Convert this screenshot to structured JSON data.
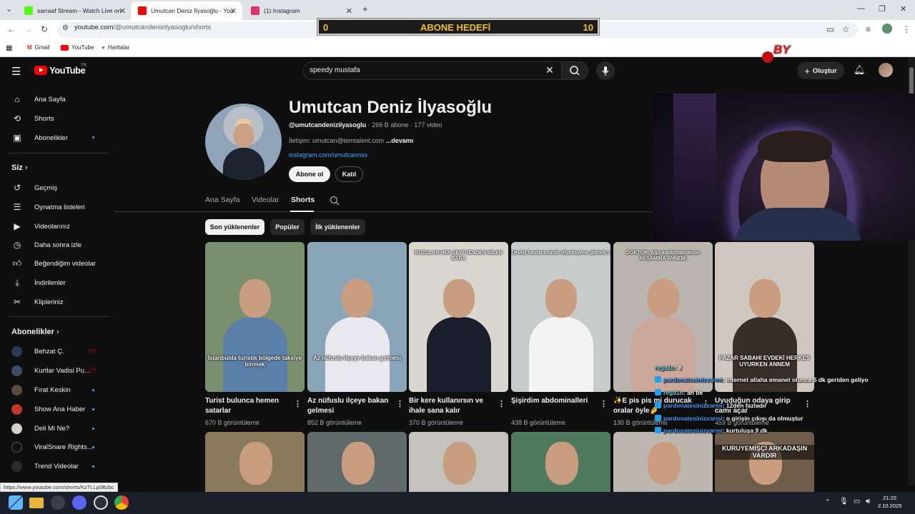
{
  "browser": {
    "tabs": [
      {
        "title": "sarraaf Stream - Watch Live on",
        "icon_color": "#53fc18"
      },
      {
        "title": "Umutcan Deniz İlyasoğlu - You",
        "icon_color": "#ff0000"
      },
      {
        "title": "(1) Instagram",
        "icon_color": "#e1306c"
      }
    ],
    "url_host": "youtube.com",
    "url_path": "/@umutcandenizilyasoglu/shorts",
    "bookmarks": [
      "Gmail",
      "YouTube",
      "Haritalar"
    ]
  },
  "overlay": {
    "goal_label": "ABONE HEDEFİ",
    "goal_current": "0",
    "goal_target": "10",
    "logo_text": "BY"
  },
  "youtube": {
    "logo_text": "YouTube",
    "region": "TR",
    "search_value": "speedy mustafa",
    "create_label": "Oluştur",
    "sidebar": {
      "main": [
        "Ana Sayfa",
        "Shorts",
        "Abonelikler"
      ],
      "you_title": "Siz",
      "you": [
        "Geçmiş",
        "Oynatma listeleri",
        "Videolarınız",
        "Daha sonra izle",
        "Beğendiğim videolar",
        "İndirilenler",
        "Klipleriniz"
      ],
      "subs_title": "Abonelikler",
      "subs": [
        "Behzat Ç.",
        "Kurtlar Vadisi Pu...",
        "Fırat Keskin",
        "Show Ana Haber",
        "Deli Mi Ne?",
        "ViralSnare Rights...",
        "Trend Videolar"
      ]
    },
    "channel": {
      "name": "Umutcan Deniz İlyasoğlu",
      "handle": "@umutcandenizilyasoglu",
      "stats": " · 266 B abone · 177 video",
      "contact": "İletişim: umutcan@temtalent.com",
      "more": "...devamı",
      "link": "instagram.com/umutcannss",
      "subscribe_label": "Abone ol",
      "join_label": "Katıl",
      "tabs": [
        "Ana Sayfa",
        "Videolar",
        "Shorts"
      ],
      "chips": [
        "Son yüklenenler",
        "Popüler",
        "İlk yüklenenler"
      ]
    },
    "shorts": [
      {
        "title": "Turist bulunca hemen satarlar",
        "views": "670 B görüntüleme",
        "caption": "İstanbulda turistik bölgede taksiye binmek",
        "caption_top": "",
        "bg": "#7a8f6e",
        "shirt": "#5a7fa8"
      },
      {
        "title": "Az nüfuslu ilçeye bakan gelmesi",
        "views": "852 B görüntüleme",
        "caption": "Az nüfuslu ilçeye bakan gelmesi",
        "caption_top": "",
        "bg": "#8aa4b8",
        "shirt": "#e8e8ee"
      },
      {
        "title": "Bir kere kullanırsın ve ihale sana kalır",
        "views": "370 B görüntüleme",
        "caption": "",
        "caption_top": "BOZULAN HER ŞEYİ SENDEN BİLEN BABA",
        "bg": "#d9d6d0",
        "shirt": "#1a1e2c"
      },
      {
        "title": "Şişirdim abdominalleri",
        "views": "438 B görüntüleme",
        "caption": "",
        "caption_top": "Devlet hastanesinde diyetisyene gitmek 2",
        "bg": "#c7cbc9",
        "shirt": "#f4f4f4"
      },
      {
        "title": "✨E pis pis mi durucak oralar öyle🤌",
        "views": "130 B görüntüleme",
        "caption": "",
        "caption_top": "DOKTOR: Ağır kaldırmamalısın AKŞAMINA ANNEM:",
        "bg": "#b9b4ae",
        "shirt": "#caa79a"
      },
      {
        "title": "Uyuduğun odaya girip camı açar",
        "views": "459 B görüntüleme",
        "caption": "PAZAR SABAHI EVDEKİ HERKES UYURKEN ANNEM",
        "caption_top": "",
        "bg": "#cfc8c0",
        "shirt": "#3a2e28"
      }
    ],
    "shorts_row2": [
      {
        "caption": "",
        "bg": "#8a7a5c"
      },
      {
        "caption": "",
        "bg": "#5e6b6a"
      },
      {
        "caption": "",
        "bg": "#c5c2bd"
      },
      {
        "caption": "",
        "bg": "#4f7a5e"
      },
      {
        "caption": "",
        "bg": "#bdb7b0"
      },
      {
        "caption": "KURUYEMİŞÇİ ARKADAŞIN VARDIR",
        "bg": "#6e5c48"
      }
    ]
  },
  "chat": [
    {
      "user": "rega1o",
      "text": ": 8"
    },
    {
      "user": "pardonatesinizvarmi",
      "text": ": internet allaha emanet olunca 5 dk geriden geliyo"
    },
    {
      "user": "rega1o",
      "text": ": ah be"
    },
    {
      "user": "pardonatesinizvarmi",
      "text": ": 12den fazladır"
    },
    {
      "user": "pardonatesinizvarmi",
      "text": ": o girişin çıkışı da olmuştur"
    },
    {
      "user": "pardonatesinizvarmi",
      "text": ": kurtuluşa 9 dk"
    }
  ],
  "status_url": "https://www.youtube.com/shorts/KzTLLp0Bzbc",
  "taskbar": {
    "time": "21:22",
    "date": "2.10.2025"
  }
}
